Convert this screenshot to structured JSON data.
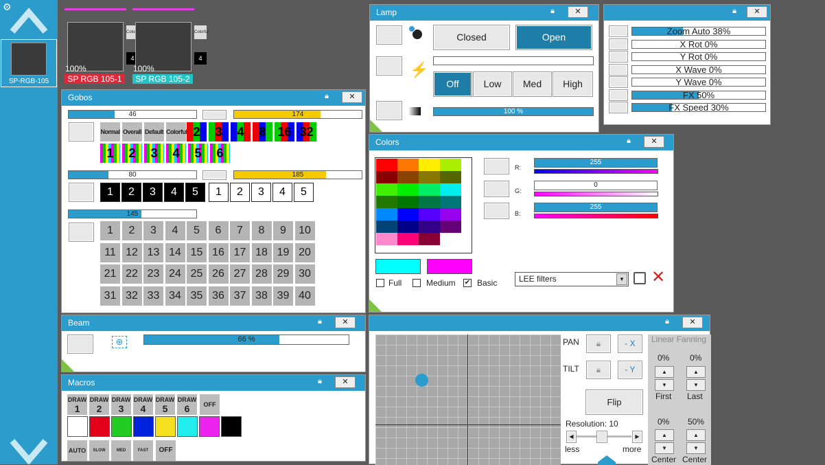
{
  "fixtures": [
    {
      "pct": "100%",
      "count": "4",
      "name": "SP RGB 105-1",
      "color": "#e0283a",
      "chip": "Colorful"
    },
    {
      "pct": "100%",
      "count": "4",
      "name": "SP RGB 105-2",
      "color": "#25c2c6",
      "chip": "Colorful"
    }
  ],
  "sidebar": {
    "fixture_label": "SP-RGB-105"
  },
  "gobos": {
    "title": "Gobos",
    "bar1": "46",
    "bar1_pct": 0.36,
    "bar2": "174",
    "bar2_pct": 0.68,
    "wheel_modes": [
      "Normal",
      "Overall",
      "Default",
      "Colorful"
    ],
    "wheel_nums": [
      "2",
      "3",
      "4",
      "8",
      "16",
      "32"
    ],
    "wheel_nums2": [
      "1",
      "2",
      "3",
      "4",
      "5",
      "6"
    ],
    "bar3": "80",
    "bar3_pct": 0.31,
    "bar4": "185",
    "bar4_pct": 0.72,
    "black": [
      "1",
      "2",
      "3",
      "4",
      "5"
    ],
    "white": [
      "1",
      "2",
      "3",
      "4",
      "5"
    ],
    "bar5": "145",
    "bar5_pct": 0.57,
    "grid": [
      "1",
      "2",
      "3",
      "4",
      "5",
      "6",
      "7",
      "8",
      "9",
      "10",
      "11",
      "12",
      "13",
      "14",
      "15",
      "16",
      "17",
      "18",
      "19",
      "20",
      "21",
      "22",
      "23",
      "24",
      "25",
      "26",
      "27",
      "28",
      "29",
      "30",
      "31",
      "32",
      "33",
      "34",
      "35",
      "36",
      "37",
      "38",
      "39",
      "40"
    ]
  },
  "beam": {
    "title": "Beam",
    "bar": "66 %",
    "pct": 0.66
  },
  "macros": {
    "title": "Macros",
    "draw": [
      [
        "DRAW",
        "1"
      ],
      [
        "DRAW",
        "2"
      ],
      [
        "DRAW",
        "3"
      ],
      [
        "DRAW",
        "4"
      ],
      [
        "DRAW",
        "5"
      ],
      [
        "DRAW",
        "6"
      ]
    ],
    "off": "OFF",
    "auto": "AUTO",
    "speeds": [
      "SLOW",
      "MED",
      "FAST"
    ],
    "off2": "OFF",
    "colors": [
      "#ffffff",
      "#e3001b",
      "#22cc22",
      "#0022dd",
      "#f5e020",
      "#22eeee",
      "#ee22ee",
      "#000000"
    ]
  },
  "lamp": {
    "title": "Lamp",
    "closed": "Closed",
    "open": "Open",
    "off": "Off",
    "low": "Low",
    "med": "Med",
    "high": "High",
    "dimmer": "100 %",
    "dimmer_pct": 1.0
  },
  "fx": {
    "items": [
      {
        "label": "Zoom Auto",
        "val": "38%",
        "pct": 0.38
      },
      {
        "label": "X Rot",
        "val": "0%",
        "pct": 0
      },
      {
        "label": "Y Rot",
        "val": "0%",
        "pct": 0
      },
      {
        "label": "X Wave",
        "val": "0%",
        "pct": 0
      },
      {
        "label": "Y Wave",
        "val": "0%",
        "pct": 0
      },
      {
        "label": "FX",
        "val": "50%",
        "pct": 0.5
      },
      {
        "label": "FX Speed",
        "val": "30%",
        "pct": 0.3
      }
    ]
  },
  "colors": {
    "title": "Colors",
    "palette": [
      "#ff0000",
      "#ff7700",
      "#ffee00",
      "#aaee00",
      "#880000",
      "#884400",
      "#887700",
      "#556600",
      "#44ee00",
      "#00ee00",
      "#00ee66",
      "#00eeee",
      "#227700",
      "#007700",
      "#007744",
      "#007777",
      "#0088ff",
      "#0000ff",
      "#5500ff",
      "#9900ee",
      "#004477",
      "#000088",
      "#330088",
      "#660077",
      "#ff88cc",
      "#ff0077",
      "#880033",
      "#ffffff"
    ],
    "r_label": "R:",
    "r": "255",
    "g_label": "G:",
    "g": "0",
    "b_label": "B:",
    "b": "255",
    "r_pct": 1.0,
    "g_pct": 0,
    "b_pct": 1.0,
    "full": "Full",
    "medium": "Medium",
    "basic": "Basic",
    "filter": "LEE filters",
    "swatch1": "#00ffff",
    "swatch2": "#ff00ff"
  },
  "position": {
    "pan": "PAN",
    "tilt": "TILT",
    "mx": "- X",
    "my": "- Y",
    "flip": "Flip",
    "resolution": "Resolution: 10",
    "less": "less",
    "more": "more",
    "fanning": "Linear Fanning",
    "first_pct": "0%",
    "last_pct": "0%",
    "first": "First",
    "last": "Last",
    "c1_pct": "0%",
    "c2_pct": "50%",
    "center1": "Center",
    "center2": "Center"
  }
}
